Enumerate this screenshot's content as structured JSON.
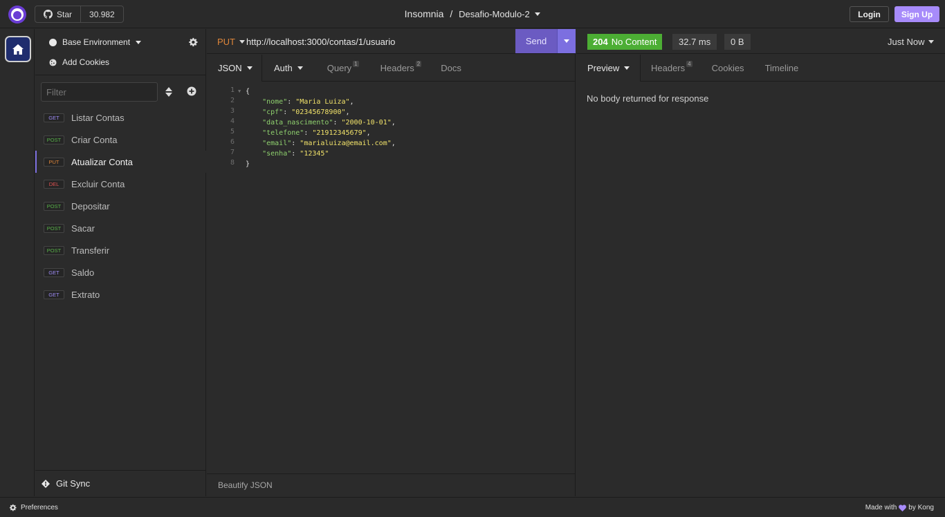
{
  "topbar": {
    "github_star_label": "Star",
    "github_star_count": "30.982",
    "app_name": "Insomnia",
    "separator": "/",
    "project_name": "Desafio-Modulo-2",
    "login_label": "Login",
    "signup_label": "Sign Up"
  },
  "sidebar": {
    "environment_label": "Base Environment",
    "add_cookies_label": "Add Cookies",
    "filter_placeholder": "Filter",
    "requests": [
      {
        "method": "GET",
        "label": "Listar Contas"
      },
      {
        "method": "POST",
        "label": "Criar Conta"
      },
      {
        "method": "PUT",
        "label": "Atualizar Conta"
      },
      {
        "method": "DEL",
        "label": "Excluir Conta"
      },
      {
        "method": "POST",
        "label": "Depositar"
      },
      {
        "method": "POST",
        "label": "Sacar"
      },
      {
        "method": "POST",
        "label": "Transferir"
      },
      {
        "method": "GET",
        "label": "Saldo"
      },
      {
        "method": "GET",
        "label": "Extrato"
      }
    ],
    "active_request_index": 2,
    "git_sync_label": "Git Sync"
  },
  "request": {
    "method": "PUT",
    "url": "http://localhost:3000/contas/1/usuario",
    "send_label": "Send",
    "tabs": {
      "body": "JSON",
      "auth": "Auth",
      "query": "Query",
      "query_count": "1",
      "headers": "Headers",
      "headers_count": "2",
      "docs": "Docs"
    },
    "body": {
      "open_brace": "{",
      "close_brace": "}",
      "fields": [
        {
          "key": "\"nome\"",
          "value": "\"Maria Luiza\"",
          "trail": ","
        },
        {
          "key": "\"cpf\"",
          "value": "\"02345678900\"",
          "trail": ","
        },
        {
          "key": "\"data_nascimento\"",
          "value": "\"2000-10-01\"",
          "trail": ","
        },
        {
          "key": "\"telefone\"",
          "value": "\"21912345679\"",
          "trail": ","
        },
        {
          "key": "\"email\"",
          "value": "\"marialuiza@email.com\"",
          "trail": ","
        },
        {
          "key": "\"senha\"",
          "value": "\"12345\"",
          "trail": ""
        }
      ],
      "line_numbers": [
        "1",
        "2",
        "3",
        "4",
        "5",
        "6",
        "7",
        "8"
      ]
    },
    "beautify_label": "Beautify JSON"
  },
  "response": {
    "status_code": "204",
    "status_text": "No Content",
    "time": "32.7 ms",
    "size": "0 B",
    "timestamp": "Just Now",
    "tabs": {
      "preview": "Preview",
      "headers": "Headers",
      "headers_count": "4",
      "cookies": "Cookies",
      "timeline": "Timeline"
    },
    "empty_message": "No body returned for response"
  },
  "footer": {
    "preferences_label": "Preferences",
    "made_with_prefix": "Made with",
    "made_with_suffix": "by Kong"
  },
  "colors": {
    "accent": "#7c6fe0",
    "status_success": "#4cae34",
    "method_get": "#9d8bf5",
    "method_post": "#59b34a",
    "method_put": "#e0863a",
    "method_delete": "#e05252",
    "json_key": "#8fd16e",
    "json_string": "#f2e36a"
  },
  "icons": [
    "insomnia-logo-icon",
    "github-icon",
    "chevron-down-icon",
    "home-icon",
    "gear-icon",
    "cookie-icon",
    "sort-icon",
    "add-circle-icon",
    "git-icon",
    "heart-icon"
  ]
}
